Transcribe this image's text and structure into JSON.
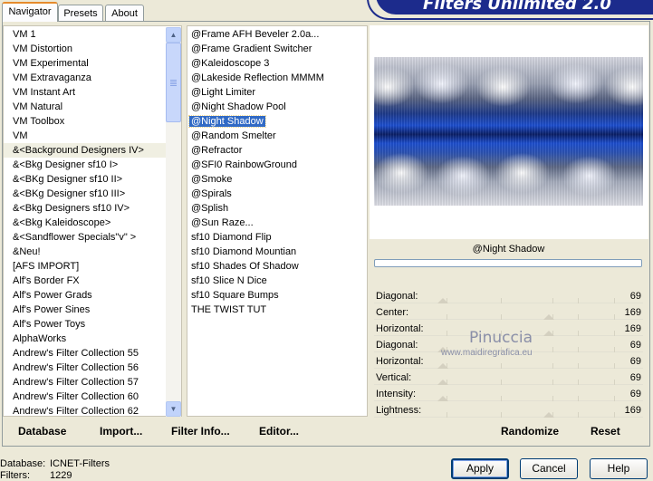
{
  "tabs": [
    {
      "label": "Navigator",
      "active": true
    },
    {
      "label": "Presets",
      "active": false
    },
    {
      "label": "About",
      "active": false
    }
  ],
  "banner_title": "Filters Unlimited 2.0",
  "categories": [
    "VM 1",
    "VM Distortion",
    "VM Experimental",
    "VM Extravaganza",
    "VM Instant Art",
    "VM Natural",
    "VM Toolbox",
    "VM",
    "&<Background Designers IV>",
    "&<Bkg Designer sf10 I>",
    "&<BKg Designer sf10 II>",
    "&<BKg Designer sf10 III>",
    "&<Bkg Designers sf10 IV>",
    "&<Bkg Kaleidoscope>",
    "&<Sandflower Specials\"v\" >",
    "&Neu!",
    "[AFS IMPORT]",
    "Alf's Border FX",
    "Alf's Power Grads",
    "Alf's Power Sines",
    "Alf's Power Toys",
    "AlphaWorks",
    "Andrew's Filter Collection 55",
    "Andrew's Filter Collection 56",
    "Andrew's Filter Collection 57",
    "Andrew's Filter Collection 60",
    "Andrew's Filter Collection 62"
  ],
  "highlighted_category_index": 8,
  "filters": [
    "@Frame AFH Beveler 2.0a...",
    "@Frame Gradient Switcher",
    "@Kaleidoscope 3",
    "@Lakeside Reflection MMMM",
    "@Light Limiter",
    "@Night Shadow Pool",
    "@Night Shadow",
    "@Random Smelter",
    "@Refractor",
    "@SFI0 RainbowGround",
    "@Smoke",
    "@Spirals",
    "@Splish",
    "@Sun Raze...",
    "sf10 Diamond Flip",
    "sf10 Diamond Mountian",
    "sf10 Shades Of Shadow",
    "sf10 Slice N Dice",
    "sf10 Square Bumps",
    "THE TWIST TUT"
  ],
  "selected_filter_index": 6,
  "scroll": {
    "up_arrow": "▲",
    "down_arrow": "▼"
  },
  "toolbar": {
    "database_label": "Database",
    "import_label": "Import...",
    "filter_info_label": "Filter Info...",
    "editor_label": "Editor..."
  },
  "preview_caption": "@Night Shadow",
  "parameters": [
    {
      "label": "Diagonal:",
      "value": "69"
    },
    {
      "label": "Center:",
      "value": "169"
    },
    {
      "label": "Horizontal:",
      "value": "169"
    },
    {
      "label": "Diagonal:",
      "value": "69"
    },
    {
      "label": "Horizontal:",
      "value": "69"
    },
    {
      "label": "Vertical:",
      "value": "69"
    },
    {
      "label": "Intensity:",
      "value": "69"
    },
    {
      "label": "Lightness:",
      "value": "169"
    }
  ],
  "watermark": {
    "line1": "Pinuccia",
    "line2": "www.maidiregrafica.eu"
  },
  "actions": {
    "randomize_label": "Randomize",
    "reset_label": "Reset"
  },
  "status": {
    "database_label": "Database:",
    "database_value": "ICNET-Filters",
    "filters_label": "Filters:",
    "filters_value": "1229"
  },
  "buttons": {
    "apply_label": "Apply",
    "cancel_label": "Cancel",
    "help_label": "Help"
  }
}
